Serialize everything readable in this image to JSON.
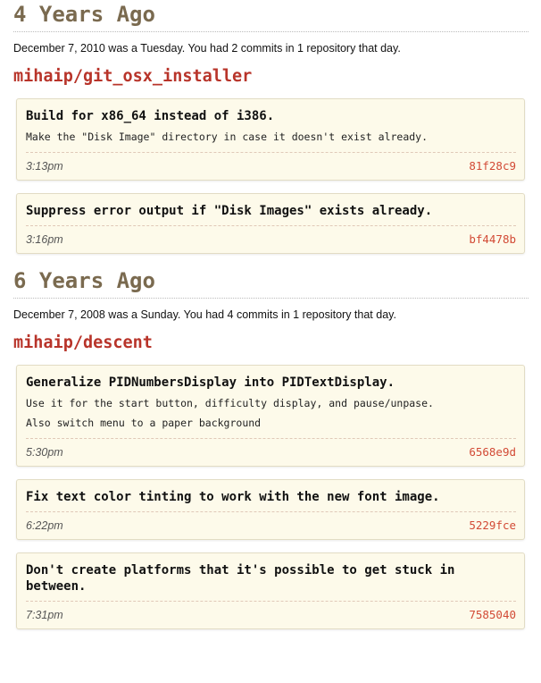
{
  "groups": [
    {
      "title": "4 Years Ago",
      "summary": "December 7, 2010 was a Tuesday. You had 2 commits in 1 repository that day.",
      "repo": "mihaip/git_osx_installer",
      "commits": [
        {
          "title": "Build for x86_64 instead of i386.",
          "body": [
            "Make the \"Disk Image\" directory in case it doesn't exist already."
          ],
          "time": "3:13pm",
          "sha": "81f28c9"
        },
        {
          "title": "Suppress error output if \"Disk Images\" exists already.",
          "body": [],
          "time": "3:16pm",
          "sha": "bf4478b"
        }
      ]
    },
    {
      "title": "6 Years Ago",
      "summary": "December 7, 2008 was a Sunday. You had 4 commits in 1 repository that day.",
      "repo": "mihaip/descent",
      "commits": [
        {
          "title": "Generalize PIDNumbersDisplay into PIDTextDisplay.",
          "body": [
            "Use it for the start button, difficulty display, and pause/unpase.",
            "Also switch menu to a paper background"
          ],
          "time": "5:30pm",
          "sha": "6568e9d"
        },
        {
          "title": "Fix text color tinting to work with the new font image.",
          "body": [],
          "time": "6:22pm",
          "sha": "5229fce"
        },
        {
          "title": "Don't create platforms that it's possible to get stuck in between.",
          "body": [],
          "time": "7:31pm",
          "sha": "7585040"
        }
      ]
    }
  ],
  "colors": {
    "section_title": "#7a6a4f",
    "repo_link": "#b8342a",
    "sha_link": "#d24a35",
    "card_bg": "#fdfaea"
  }
}
